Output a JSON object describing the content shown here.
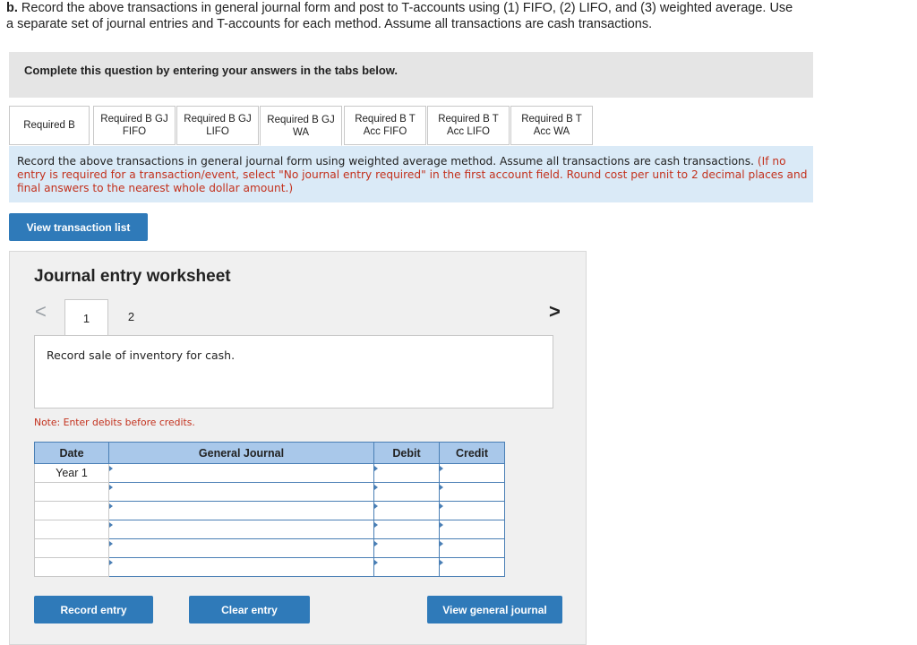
{
  "question": {
    "prefix": "b.",
    "line1": "Record the above transactions in general journal form and post to T-accounts using (1) FIFO, (2) LIFO, and (3) weighted average. Use",
    "line2": "a separate set of journal entries and T-accounts for each method. Assume all transactions are cash transactions."
  },
  "banner": "Complete this question by entering your answers in the tabs below.",
  "tabs": [
    {
      "label": "Required B"
    },
    {
      "label": "Required B GJ\nFIFO"
    },
    {
      "label": "Required B GJ\nLIFO"
    },
    {
      "label": "Required B GJ\nWA"
    },
    {
      "label": "Required B T\nAcc FIFO"
    },
    {
      "label": "Required B T\nAcc LIFO"
    },
    {
      "label": "Required B T\nAcc WA"
    }
  ],
  "instruction": {
    "main": "Record the above transactions in general journal form using weighted average method. Assume all transactions are cash transactions.",
    "red": "(If no entry is required for a transaction/event, select \"No journal entry required\" in the first account field. Round cost per unit to 2 decimal places and final answers to the nearest whole dollar amount.)"
  },
  "view_transaction_list": "View transaction list",
  "worksheet": {
    "title": "Journal entry worksheet",
    "pages": [
      "1",
      "2"
    ],
    "prev_arrow": "<",
    "next_arrow": ">",
    "description": "Record sale of inventory for cash.",
    "note": "Note: Enter debits before credits.",
    "columns": [
      "Date",
      "General Journal",
      "Debit",
      "Credit"
    ],
    "rows": [
      {
        "date": "Year 1"
      },
      {
        "date": ""
      },
      {
        "date": ""
      },
      {
        "date": ""
      },
      {
        "date": ""
      },
      {
        "date": ""
      }
    ],
    "record_entry": "Record entry",
    "clear_entry": "Clear entry",
    "view_general_journal": "View general journal"
  },
  "colors": {
    "button": "#2f7ab9",
    "header_cell": "#a9c8ea",
    "instruction_bg": "#daeaf7",
    "red_text": "#c3311d"
  }
}
